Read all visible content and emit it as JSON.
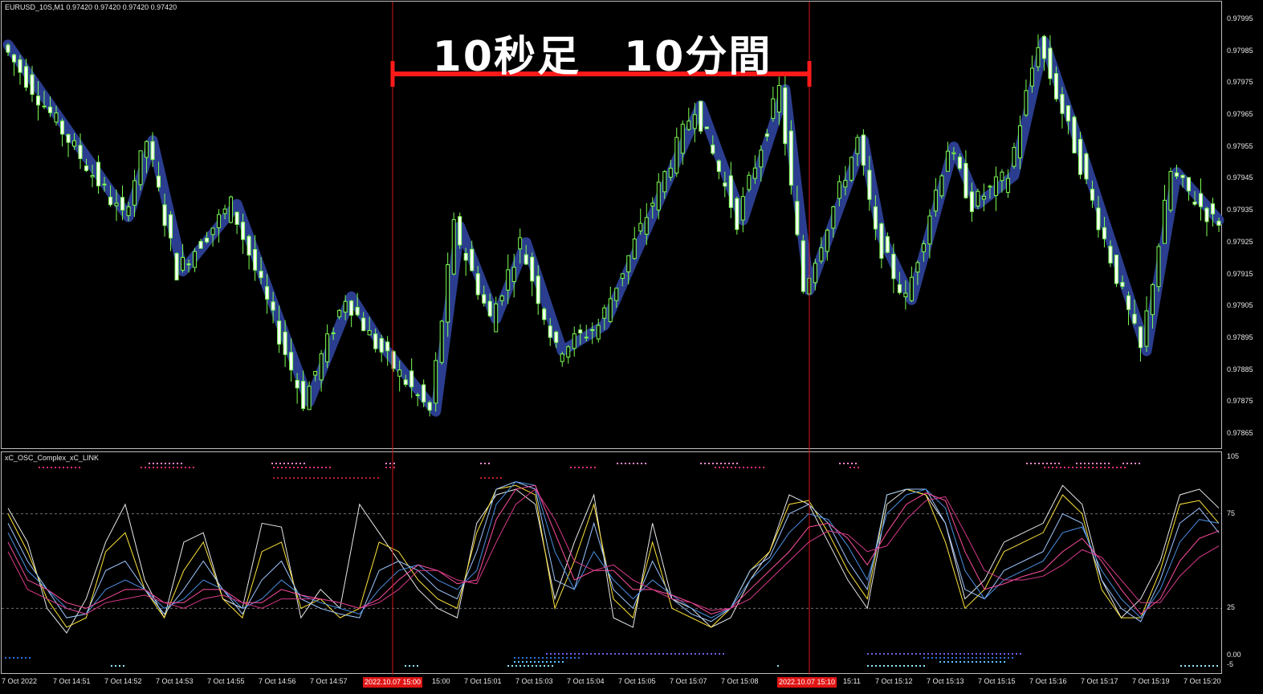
{
  "main_title": "EURUSD_10S,M1  0.97420 0.97420 0.97420 0.97420",
  "osc_title": "xC_OSC_Complex_xC_LINK",
  "annotation": "10秒足　10分間",
  "price_labels": [
    "0.97995",
    "0.97985",
    "0.97975",
    "0.97965",
    "0.97955",
    "0.97945",
    "0.97935",
    "0.97925",
    "0.97915",
    "0.97905",
    "0.97895",
    "0.97885",
    "0.97875",
    "0.97865"
  ],
  "osc_labels": [
    "105",
    "75",
    "25",
    "0.00",
    "-5"
  ],
  "time_labels": [
    "7 Oct 2022",
    "7 Oct 14:51",
    "7 Oct 14:52",
    "7 Oct 14:53",
    "7 Oct 14:55",
    "7 Oct 14:56",
    "7 Oct 14:57",
    "2022.10.07 15:00",
    "15:00",
    "7 Oct 15:01",
    "7 Oct 15:03",
    "7 Oct 15:04",
    "7 Oct 15:05",
    "7 Oct 15:07",
    "7 Oct 15:08",
    "2022.10.07 15:10",
    "15:11",
    "7 Oct 15:12",
    "7 Oct 15:13",
    "7 Oct 15:15",
    "7 Oct 15:16",
    "7 Oct 15:17",
    "7 Oct 15:19",
    "7 Oct 15:20"
  ],
  "colors": {
    "bg": "#000000",
    "zigzag": "#2b3d8f",
    "bull": "#7cff52",
    "bear": "#ffffff",
    "vline": "#d01818",
    "grid": "#6e6e6e"
  },
  "chart_data": [
    {
      "type": "line",
      "title": "",
      "ylim": [
        0.9786,
        0.98
      ],
      "series": [
        {
          "x_index": [
            0,
            20,
            24,
            29,
            38,
            50,
            57,
            62,
            71,
            75,
            81,
            86,
            92,
            99,
            115,
            122,
            129,
            133,
            142,
            145,
            150,
            157,
            161,
            167,
            172,
            178,
            189,
            194,
            201
          ],
          "values": [
            0.97987,
            0.97933,
            0.97957,
            0.97916,
            0.97937,
            0.97875,
            0.97908,
            0.97893,
            0.97872,
            0.9793,
            0.97901,
            0.97925,
            0.97891,
            0.97899,
            0.97968,
            0.97932,
            0.97973,
            0.9791,
            0.97957,
            0.97927,
            0.97907,
            0.97955,
            0.97937,
            0.97946,
            0.97988,
            0.97955,
            0.97891,
            0.97947,
            0.97932
          ]
        }
      ]
    },
    {
      "type": "line",
      "title": "",
      "ylim": [
        -5,
        105
      ],
      "series": [
        {
          "values": [
            78,
            60,
            25,
            12,
            30,
            60,
            80,
            40,
            20,
            60,
            65,
            30,
            25,
            70,
            68,
            20,
            35,
            25,
            80,
            65,
            50,
            35,
            25,
            20,
            70,
            85,
            88,
            80,
            30,
            60,
            85,
            20,
            15,
            70,
            30,
            25,
            15,
            20,
            40,
            55,
            85,
            80,
            60,
            40,
            25,
            80,
            88,
            85,
            70,
            30,
            40,
            60,
            65,
            70,
            90,
            80,
            40,
            20,
            30,
            50,
            85,
            88,
            78
          ]
        },
        {
          "values": [
            75,
            55,
            30,
            15,
            20,
            55,
            65,
            35,
            20,
            45,
            60,
            30,
            20,
            55,
            60,
            25,
            30,
            20,
            25,
            60,
            55,
            40,
            30,
            25,
            65,
            88,
            90,
            85,
            25,
            50,
            80,
            30,
            20,
            60,
            25,
            20,
            15,
            25,
            45,
            55,
            80,
            82,
            65,
            45,
            30,
            85,
            88,
            85,
            60,
            25,
            35,
            55,
            60,
            65,
            85,
            75,
            35,
            20,
            20,
            45,
            80,
            82,
            70
          ]
        },
        {
          "values": [
            70,
            50,
            35,
            20,
            22,
            45,
            50,
            35,
            22,
            35,
            50,
            35,
            22,
            40,
            50,
            30,
            25,
            22,
            20,
            45,
            50,
            45,
            35,
            30,
            55,
            88,
            92,
            88,
            40,
            35,
            70,
            35,
            25,
            50,
            30,
            22,
            18,
            25,
            45,
            52,
            75,
            80,
            70,
            50,
            35,
            85,
            88,
            88,
            70,
            35,
            30,
            45,
            50,
            55,
            75,
            70,
            40,
            25,
            18,
            40,
            70,
            78,
            65
          ]
        },
        {
          "values": [
            65,
            45,
            35,
            25,
            22,
            35,
            40,
            35,
            25,
            30,
            40,
            35,
            25,
            30,
            40,
            32,
            28,
            25,
            22,
            35,
            45,
            48,
            40,
            35,
            45,
            80,
            92,
            90,
            55,
            35,
            55,
            40,
            30,
            40,
            32,
            25,
            20,
            25,
            40,
            50,
            65,
            75,
            72,
            58,
            40,
            75,
            85,
            88,
            78,
            45,
            30,
            40,
            45,
            50,
            65,
            68,
            45,
            30,
            20,
            35,
            60,
            72,
            70
          ]
        },
        {
          "values": [
            60,
            40,
            35,
            28,
            25,
            30,
            35,
            35,
            28,
            28,
            35,
            35,
            28,
            28,
            35,
            32,
            30,
            28,
            25,
            30,
            40,
            48,
            45,
            38,
            40,
            72,
            88,
            90,
            65,
            40,
            45,
            45,
            35,
            35,
            32,
            28,
            22,
            25,
            35,
            45,
            55,
            68,
            70,
            62,
            48,
            65,
            80,
            86,
            82,
            55,
            35,
            38,
            42,
            45,
            55,
            62,
            50,
            35,
            22,
            30,
            50,
            62,
            66
          ]
        },
        {
          "values": [
            55,
            35,
            30,
            25,
            22,
            28,
            30,
            32,
            28,
            25,
            30,
            32,
            28,
            25,
            30,
            30,
            30,
            28,
            25,
            28,
            35,
            45,
            45,
            40,
            38,
            60,
            80,
            88,
            72,
            50,
            45,
            48,
            40,
            35,
            30,
            28,
            24,
            25,
            30,
            40,
            50,
            60,
            66,
            64,
            55,
            58,
            72,
            82,
            84,
            65,
            45,
            40,
            40,
            42,
            48,
            56,
            52,
            40,
            28,
            28,
            42,
            52,
            58
          ]
        }
      ]
    }
  ]
}
